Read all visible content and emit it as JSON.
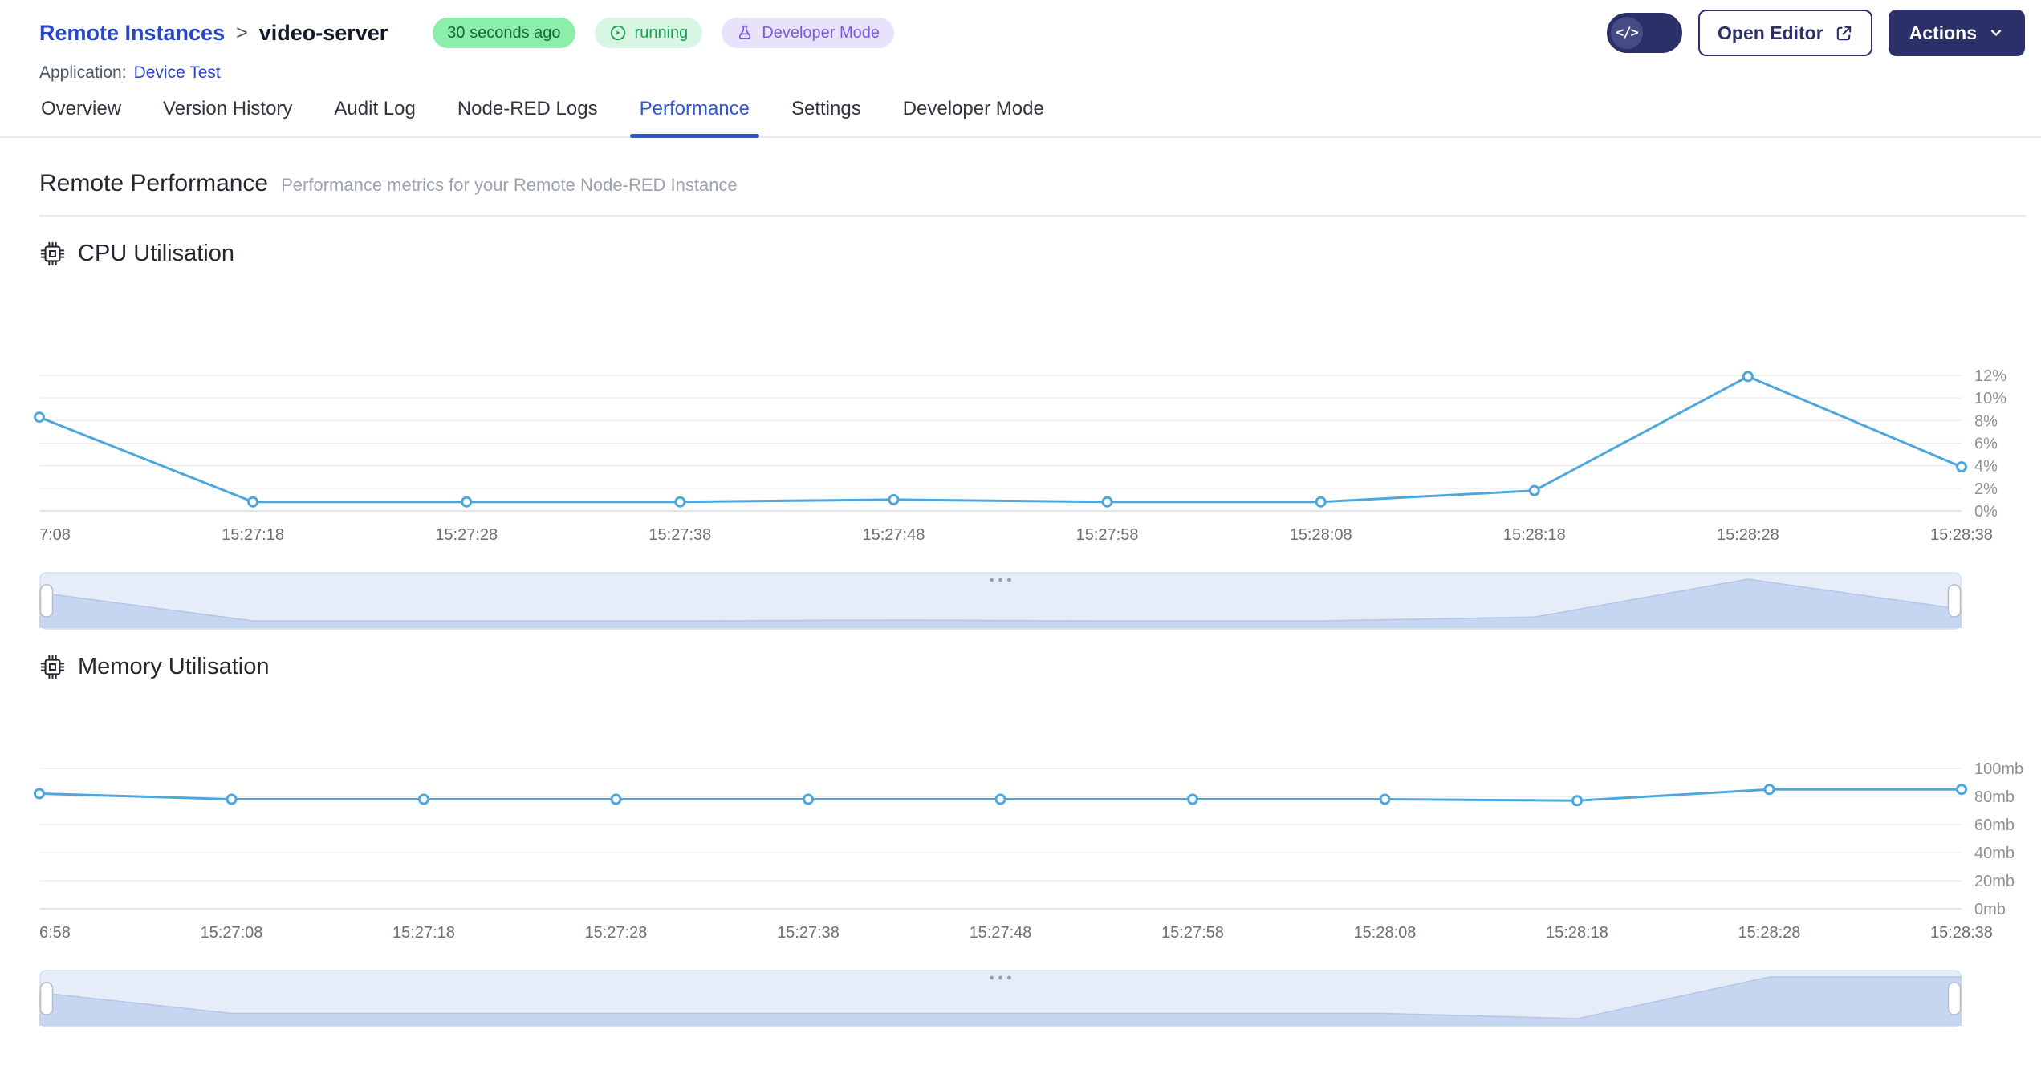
{
  "header": {
    "breadcrumb": "Remote Instances",
    "separator": ">",
    "instance_name": "video-server",
    "badges": {
      "last_seen": "30 seconds ago",
      "status": "running",
      "mode": "Developer Mode"
    },
    "application_label": "Application:",
    "application_name": "Device Test",
    "open_editor_label": "Open Editor",
    "actions_label": "Actions",
    "icons": {
      "code_glyph": "</>"
    }
  },
  "tabs": [
    {
      "label": "Overview",
      "active": false
    },
    {
      "label": "Version History",
      "active": false
    },
    {
      "label": "Audit Log",
      "active": false
    },
    {
      "label": "Node-RED Logs",
      "active": false
    },
    {
      "label": "Performance",
      "active": true
    },
    {
      "label": "Settings",
      "active": false
    },
    {
      "label": "Developer Mode",
      "active": false
    }
  ],
  "page": {
    "title": "Remote Performance",
    "subtitle": "Performance metrics for your Remote Node-RED Instance"
  },
  "sections": [
    {
      "title": "CPU Utilisation"
    },
    {
      "title": "Memory Utilisation"
    }
  ],
  "colors": {
    "accent_blue": "#3157d2",
    "navy": "#2b3168",
    "link_blue": "#2847c8",
    "chart_line": "#4ea7dc",
    "badge_green_bg": "#8ceeab",
    "badge_green_text": "#116b3c",
    "running_bg": "#d9f6e4",
    "running_text": "#1c9e53",
    "dev_badge_bg": "#e8e3fa",
    "dev_badge_text": "#7a5cd9",
    "brush_bg": "#e7edf8",
    "brush_fill": "#c7d6f0"
  },
  "chart_data": [
    {
      "type": "line",
      "title": "CPU Utilisation",
      "x": [
        "7:08",
        "15:27:18",
        "15:27:28",
        "15:27:38",
        "15:27:48",
        "15:27:58",
        "15:28:08",
        "15:28:18",
        "15:28:28",
        "15:28:38"
      ],
      "values": [
        8.3,
        0.8,
        0.8,
        0.8,
        1.0,
        0.8,
        0.8,
        1.8,
        11.9,
        3.9
      ],
      "xlabel": "",
      "ylabel": "",
      "ylim": [
        0,
        12
      ],
      "y_ticks": [
        0,
        2,
        4,
        6,
        8,
        10,
        12
      ],
      "y_tick_labels": [
        "0%",
        "2%",
        "4%",
        "6%",
        "8%",
        "10%",
        "12%"
      ],
      "y_axis_position": "right",
      "grid": true,
      "legend": false,
      "line_color": "#4ea7dc"
    },
    {
      "type": "line",
      "title": "Memory Utilisation",
      "x": [
        "6:58",
        "15:27:08",
        "15:27:18",
        "15:27:28",
        "15:27:38",
        "15:27:48",
        "15:27:58",
        "15:28:08",
        "15:28:18",
        "15:28:28",
        "15:28:38"
      ],
      "values": [
        82,
        78,
        78,
        78,
        78,
        78,
        78,
        78,
        77,
        85,
        85
      ],
      "xlabel": "",
      "ylabel": "",
      "ylim": [
        0,
        100
      ],
      "y_ticks": [
        0,
        20,
        40,
        60,
        80,
        100
      ],
      "y_tick_labels": [
        "0mb",
        "20mb",
        "40mb",
        "60mb",
        "80mb",
        "100mb"
      ],
      "y_axis_position": "right",
      "grid": true,
      "legend": false,
      "line_color": "#4ea7dc"
    }
  ]
}
